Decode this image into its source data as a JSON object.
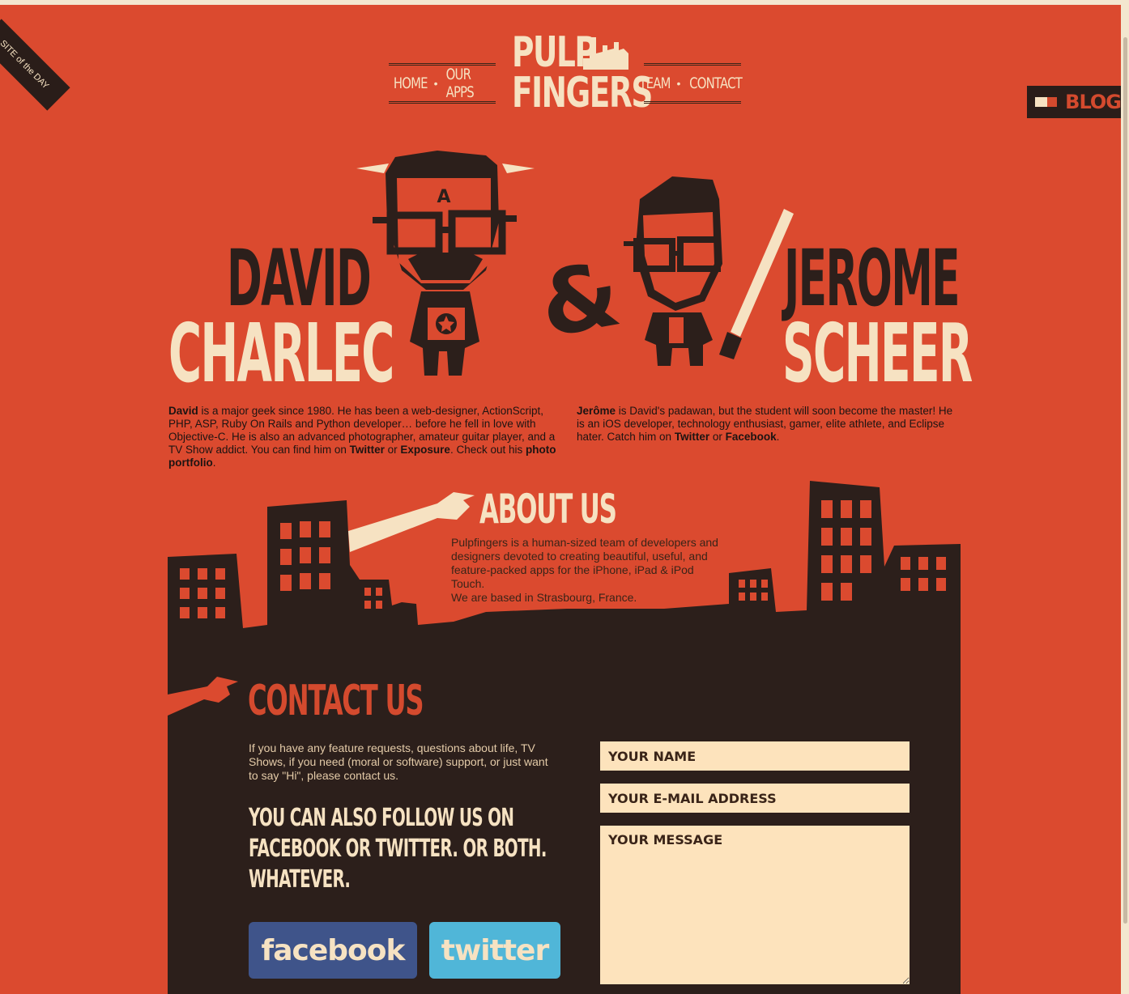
{
  "nav": {
    "left": [
      "HOME",
      "OUR APPS"
    ],
    "right": [
      "TEAM",
      "CONTACT"
    ],
    "separator": "•"
  },
  "logo": {
    "line1": "PULP",
    "line2": "FINGERS"
  },
  "blog_tab": {
    "label": "BLOG"
  },
  "site_of_the_day": {
    "line1": "SITE of",
    "line2": "the DAY"
  },
  "team": {
    "david": {
      "first": "DAVID",
      "last": "CHARLEC",
      "bio_name": "David",
      "bio_1": " is a major geek since 1980. He has been a web-designer, ActionScript, PHP, ASP, Ruby On Rails and Python developer… before he fell in love with Objective-C. He is also an advanced photographer, amateur guitar player, and a TV Show addict. You can find him on ",
      "link_twitter": "Twitter",
      "or": " or ",
      "link_exposure": "Exposure",
      "bio_2": ". Check out his ",
      "link_portfolio": "photo portfolio",
      "end": "."
    },
    "ampersand": "&",
    "jerome": {
      "first": "JEROME",
      "last": "SCHEER",
      "bio_name": "Jerôme",
      "bio_1": " is David's padawan, but the student will soon become the master! He is an iOS developer, technology enthusiast, gamer, elite athlete, and Eclipse hater. Catch him on ",
      "link_twitter": "Twitter",
      "or": " or ",
      "link_facebook": "Facebook",
      "end": "."
    },
    "david_badge": "A"
  },
  "about": {
    "title": "ABOUT US",
    "text_1": "Pulpfingers is a human-sized team of developers and designers devoted to creating beautiful, useful, and feature-packed apps for the iPhone, iPad & iPod Touch.",
    "text_2": "We are based in Strasbourg, France."
  },
  "contact": {
    "title": "CONTACT US",
    "text": "If you have any feature requests, questions about life, TV Shows, if you need (moral or software) support, or just want to say \"Hi\", please contact us.",
    "follow_1": "YOU CAN ALSO FOLLOW US ON",
    "follow_2": "FACEBOOK OR TWITTER. OR BOTH.",
    "follow_3": "WHATEVER.",
    "facebook_label": "facebook",
    "twitter_label": "twitter",
    "name_placeholder": "YOUR NAME",
    "email_placeholder": "YOUR E-MAIL ADDRESS",
    "message_placeholder": "YOUR MESSAGE"
  },
  "colors": {
    "background": "#db4a2f",
    "dark": "#2c1f1b",
    "cream": "#f6e2c2",
    "facebook": "#3f548a",
    "twitter": "#50b6d8"
  }
}
